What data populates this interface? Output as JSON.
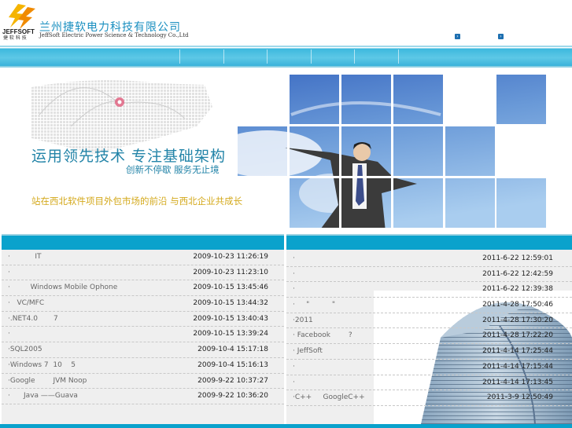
{
  "header": {
    "logo_text": "JEFFSOFT",
    "logo_sub": "捷软科技",
    "company_cn": "兰州捷软电力科技有限公司",
    "company_en": "JeffSoft Electric Power Science & Technology Co.,Ltd",
    "link_icons": [
      "arrow-right-icon",
      "arrow-right-icon"
    ]
  },
  "banner": {
    "slogan_main": "运用领先技术  专注基础架构",
    "slogan_sub": "创新不停歇  服务无止境",
    "slogan_bottom": "站在西北软件项目外包市场的前沿  与西北企业共成长"
  },
  "left_list": {
    "items": [
      {
        "title": "·           IT",
        "date": "2009-10-23 11:26:19"
      },
      {
        "title": "·",
        "date": "2009-10-23 11:23:10"
      },
      {
        "title": "·         Windows Mobile Ophone",
        "date": "2009-10-15 13:45:46"
      },
      {
        "title": "·   VC/MFC",
        "date": "2009-10-15 13:44:32"
      },
      {
        "title": "·.NET4.0       7",
        "date": "2009-10-15 13:40:43"
      },
      {
        "title": "·",
        "date": "2009-10-15 13:39:24"
      },
      {
        "title": "·SQL2005",
        "date": "2009-10-4 15:17:18"
      },
      {
        "title": "·Windows 7  10    5",
        "date": "2009-10-4 15:16:13"
      },
      {
        "title": "·Google        JVM Noop",
        "date": "2009-9-22 10:37:27"
      },
      {
        "title": "·      Java ——Guava",
        "date": "2009-9-22 10:36:20"
      }
    ]
  },
  "right_list": {
    "items": [
      {
        "title": "·",
        "date": "2011-6-22 12:59:01"
      },
      {
        "title": "·",
        "date": "2011-6-22 12:42:59"
      },
      {
        "title": "·",
        "date": "2011-6-22 12:39:38"
      },
      {
        "title": "·     \"          \"",
        "date": "2011-4-28 17:50:46"
      },
      {
        "title": "·2011",
        "date": "2011-4-28 17:30:20"
      },
      {
        "title": "· Facebook        ?",
        "date": "2011-4-28 17:22:20"
      },
      {
        "title": "· JeffSoft",
        "date": "2011-4-14 17:25:44"
      },
      {
        "title": "·",
        "date": "2011-4-14 17:15:44"
      },
      {
        "title": "·",
        "date": "2011-4-14 17:13:45"
      },
      {
        "title": "·C++     GoogleC++",
        "date": "2011-3-9 12:50:49"
      }
    ]
  },
  "colors": {
    "accent": "#0aa2cc",
    "brand_text": "#1a8fc0",
    "slogan_gold": "#d4a91c"
  }
}
